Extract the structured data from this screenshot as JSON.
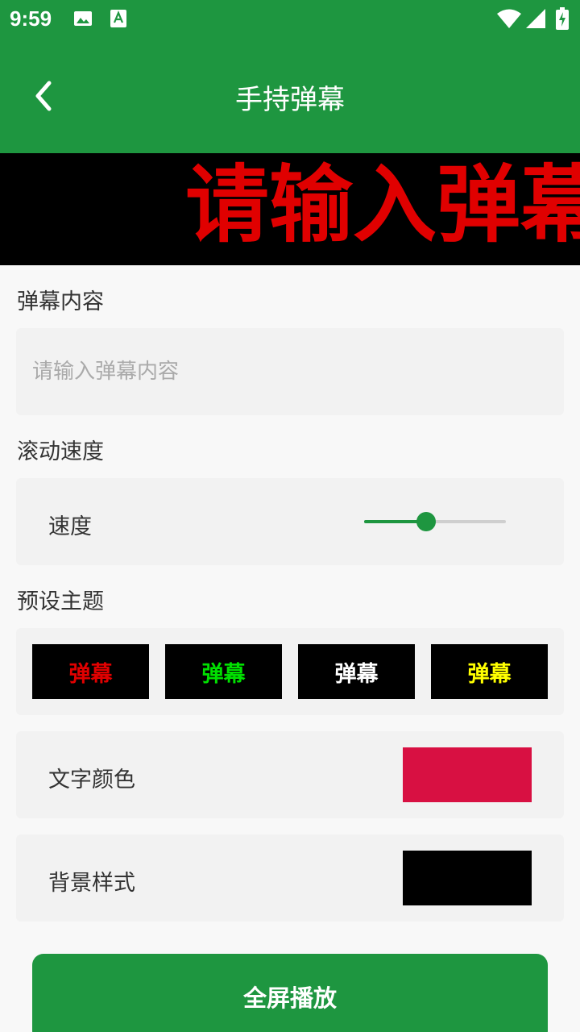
{
  "status_bar": {
    "time": "9:59",
    "left_icons": [
      "image-icon",
      "text-a-icon"
    ],
    "right_icons": [
      "wifi-icon",
      "signal-icon",
      "battery-charging-icon"
    ]
  },
  "app_bar": {
    "title": "手持弹幕",
    "back_icon": "chevron-left-icon",
    "color": "#1e9640"
  },
  "preview": {
    "text": "请输入弹幕",
    "text_color": "#e00000",
    "background": "#000000"
  },
  "content_section": {
    "label": "弹幕内容",
    "input_value": "",
    "input_placeholder": "请输入弹幕内容"
  },
  "speed_section": {
    "label": "滚动速度",
    "row_label": "速度",
    "value_fraction": 0.44
  },
  "theme_section": {
    "label": "预设主题",
    "themes": [
      {
        "text": "弹幕",
        "color": "#e00000",
        "background": "#000000"
      },
      {
        "text": "弹幕",
        "color": "#00e000",
        "background": "#000000"
      },
      {
        "text": "弹幕",
        "color": "#ffffff",
        "background": "#000000"
      },
      {
        "text": "弹幕",
        "color": "#ffff00",
        "background": "#000000"
      }
    ]
  },
  "text_color_row": {
    "label": "文字颜色",
    "color": "#d81042"
  },
  "background_row": {
    "label": "背景样式",
    "color": "#000000"
  },
  "play_button": {
    "label": "全屏播放"
  }
}
